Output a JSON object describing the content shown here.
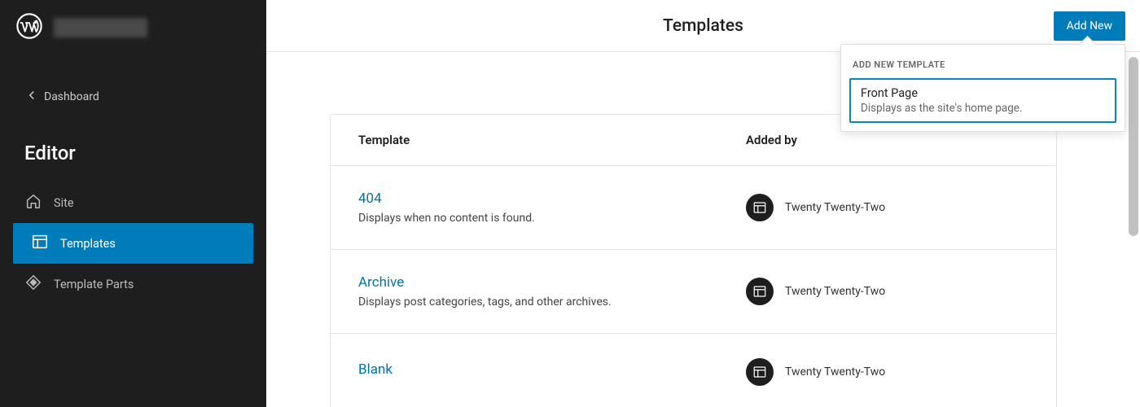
{
  "sidebar": {
    "back_label": "Dashboard",
    "heading": "Editor",
    "items": [
      {
        "label": "Site"
      },
      {
        "label": "Templates"
      },
      {
        "label": "Template Parts"
      }
    ]
  },
  "topbar": {
    "title": "Templates",
    "add_new": "Add New"
  },
  "dropdown": {
    "header": "ADD NEW TEMPLATE",
    "item_title": "Front Page",
    "item_desc": "Displays as the site's home page."
  },
  "table": {
    "col_template": "Template",
    "col_addedby": "Added by",
    "rows": [
      {
        "title": "404",
        "desc": "Displays when no content is found.",
        "theme": "Twenty Twenty-Two"
      },
      {
        "title": "Archive",
        "desc": "Displays post categories, tags, and other archives.",
        "theme": "Twenty Twenty-Two"
      },
      {
        "title": "Blank",
        "desc": "",
        "theme": "Twenty Twenty-Two"
      }
    ]
  }
}
